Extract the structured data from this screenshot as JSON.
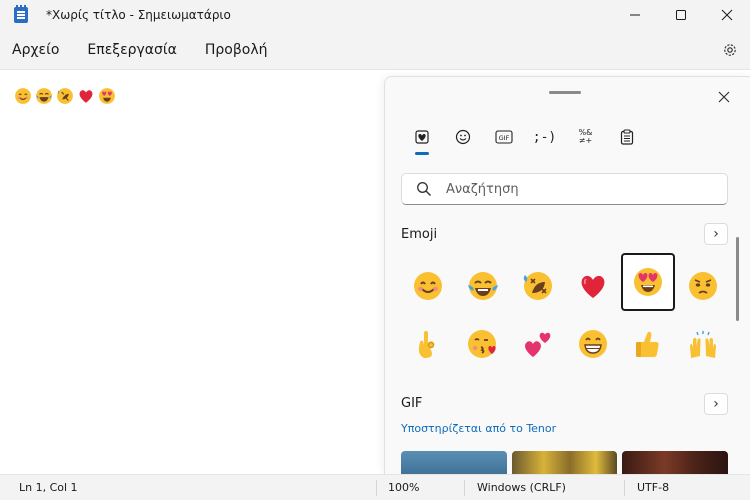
{
  "window": {
    "title": "*Χωρίς τίτλο - Σημειωματάριο",
    "minimize_glyph": "—",
    "maximize_glyph": "☐",
    "close_glyph": "✕"
  },
  "menu": {
    "file": "Αρχείο",
    "edit": "Επεξεργασία",
    "view": "Προβολή"
  },
  "editor": {
    "content_emojis": [
      "smiling-face-with-smiling-eyes",
      "face-with-tears-of-joy",
      "rolling-on-floor-laughing",
      "red-heart",
      "smiling-face-with-heart-eyes"
    ]
  },
  "status": {
    "position": "Ln 1, Col 1",
    "zoom": "100%",
    "line_ending": "Windows (CRLF)",
    "encoding": "UTF-8"
  },
  "panel": {
    "close_glyph": "✕",
    "tabs": [
      {
        "name": "favorites",
        "icon": "heart-card-icon",
        "active": true
      },
      {
        "name": "emoji",
        "icon": "smiley-icon",
        "active": false
      },
      {
        "name": "gif",
        "icon": "gif-icon",
        "label": "GIF",
        "active": false
      },
      {
        "name": "kaomoji",
        "icon": "kaomoji-icon",
        "label": ";-)",
        "active": false
      },
      {
        "name": "symbols",
        "icon": "symbols-icon",
        "label": "%&≠+",
        "active": false
      },
      {
        "name": "clipboard",
        "icon": "clipboard-icon",
        "active": false
      }
    ],
    "search_placeholder": "Αναζήτηση",
    "emoji_section": {
      "title": "Emoji",
      "more_glyph": "›",
      "items": [
        {
          "name": "smiling-face-with-smiling-eyes",
          "selected": false
        },
        {
          "name": "face-with-tears-of-joy",
          "selected": false
        },
        {
          "name": "rolling-on-floor-laughing",
          "selected": false
        },
        {
          "name": "red-heart",
          "selected": false
        },
        {
          "name": "smiling-face-with-heart-eyes",
          "selected": true
        },
        {
          "name": "pleading-sad-face",
          "selected": false
        },
        {
          "name": "ok-hand",
          "selected": false
        },
        {
          "name": "face-blowing-kiss",
          "selected": false
        },
        {
          "name": "two-hearts",
          "selected": false
        },
        {
          "name": "beaming-face",
          "selected": false
        },
        {
          "name": "thumbs-up",
          "selected": false
        },
        {
          "name": "raising-hands",
          "selected": false
        }
      ]
    },
    "gif_section": {
      "title": "GIF",
      "more_glyph": "›",
      "powered_by": "Υποστηρίζεται από το Tenor"
    }
  },
  "colors": {
    "accent": "#0f6cbd",
    "emoji_yellow": "#f9c031",
    "heart_red": "#e0243a"
  }
}
